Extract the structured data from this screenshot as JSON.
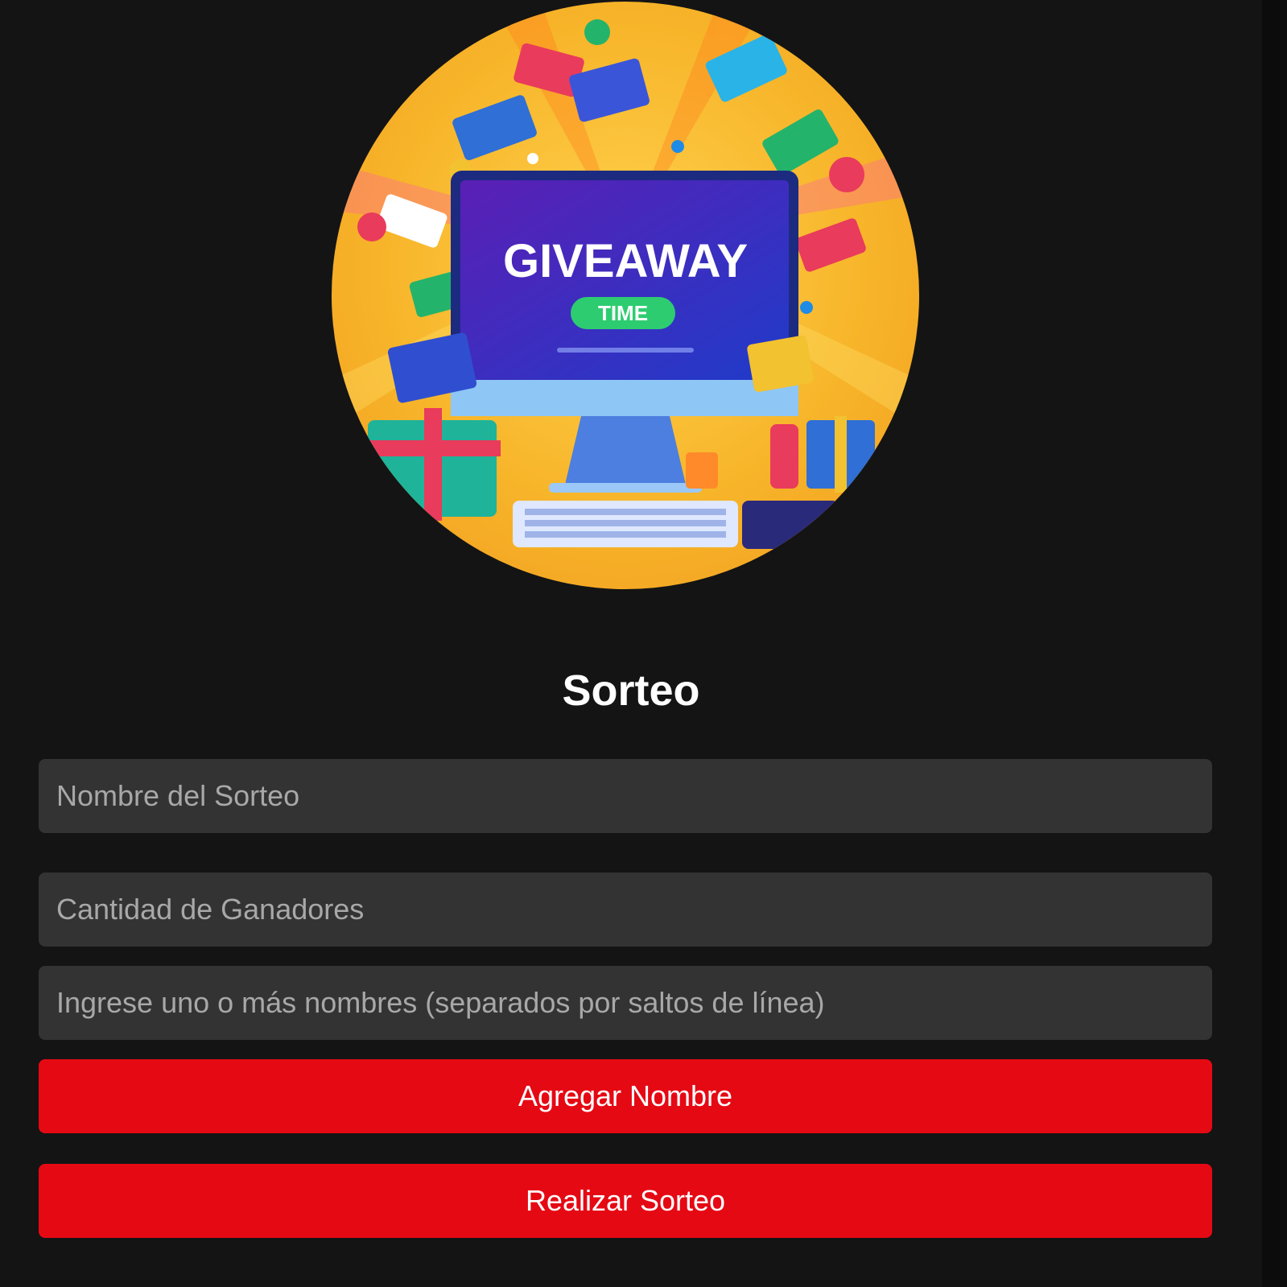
{
  "hero": {
    "headline": "GIVEAWAY",
    "badge": "TIME",
    "colors": {
      "background": "#f7b52a",
      "screen": "#3a1d9a",
      "badge": "#2ecc71"
    }
  },
  "form": {
    "title": "Sorteo",
    "name_field": {
      "placeholder": "Nombre del Sorteo",
      "value": ""
    },
    "winners_field": {
      "placeholder": "Cantidad de Ganadores",
      "value": ""
    },
    "names_textarea": {
      "placeholder": "Ingrese uno o más nombres (separados por saltos de línea)",
      "value": ""
    },
    "add_button_label": "Agregar Nombre",
    "draw_button_label": "Realizar Sorteo"
  },
  "theme": {
    "background": "#141414",
    "field_background": "#333333",
    "accent": "#e50914",
    "text": "#ffffff"
  }
}
